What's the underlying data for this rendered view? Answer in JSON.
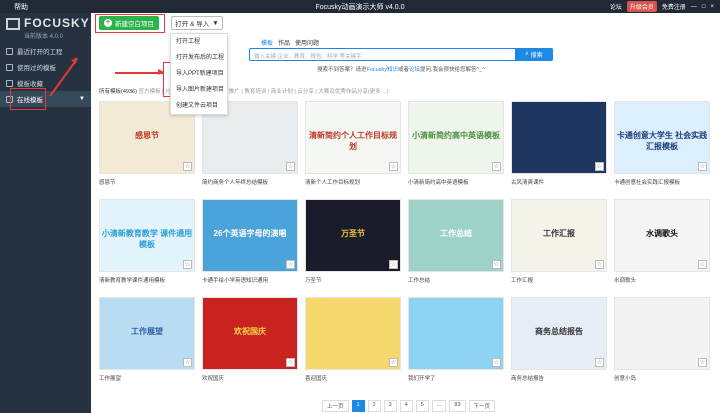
{
  "titlebar": {
    "help": "帮助",
    "title": "Focusky动画演示大师 v4.0.0",
    "forum": "论坛",
    "upgrade": "升级会员",
    "account": "免费注册",
    "min": "—",
    "max": "□",
    "close": "×"
  },
  "sidebar": {
    "logo_name": "FOCUSKY",
    "version": "当前版本 4.0.0",
    "items": [
      {
        "label": "最近打开的工程",
        "icon": "folder-icon"
      },
      {
        "label": "使用过的模板",
        "icon": "template-icon"
      },
      {
        "label": "模板收藏",
        "icon": "star-icon"
      },
      {
        "label": "在线模板",
        "icon": "cloud-icon",
        "caret": "▼"
      }
    ]
  },
  "toolbar": {
    "new_label": "新建空白项目",
    "new_icon": "+",
    "open_label": "打开 & 导入",
    "open_caret": "▼",
    "dropdown": [
      "打开工程",
      "打开发布后的工程",
      "导入PPT新建项目",
      "导入图片新建项目",
      "创建文件云项目"
    ]
  },
  "search": {
    "tabs": [
      "模板",
      "作品",
      "使用问题"
    ],
    "placeholder": "输入关键 企业、教育、报告、科学 等关键字",
    "button": "搜索",
    "hint_before": "搜索不到答案？请进",
    "hint_link1": "Focusky知识",
    "hint_mid": "或者",
    "hint_link2": "论坛",
    "hint_after": "提问,我会很快给您解答^_^"
  },
  "filter": {
    "all": "所有模板(4936)",
    "rest": "官方模板 | 分类模板 | 精选模板 | 企业推广 | 教育培训 | 商业计划 | 云分享 | 大赛及优秀作品分享(更多 ...)"
  },
  "templates": [
    {
      "caption": "感恩节",
      "title": "感恩节",
      "bg": "#f3ead6",
      "color": "#c0392b"
    },
    {
      "caption": "简约商务个人年终总结模板",
      "title": "",
      "bg": "#e9ecef",
      "color": "#333"
    },
    {
      "caption": "清新个人工作目标规划",
      "title": "清新简约个人工作目标规划",
      "bg": "#f4f7f2",
      "color": "#c0392b"
    },
    {
      "caption": "小清新简约高中英语模板",
      "title": "小清新简约高中英语模板",
      "bg": "#eef5ea",
      "color": "#4b8f45"
    },
    {
      "caption": "古风清爽课件",
      "title": "",
      "bg": "#1f3760",
      "color": "#fff"
    },
    {
      "caption": "卡通创意社会实践汇报模板",
      "title": "卡通创意大学生 社会实践汇报模板",
      "bg": "#dcefff",
      "color": "#1d3f7a"
    },
    {
      "caption": "清新教育教学课件通用模板",
      "title": "小清新教育教学 课件通用模板",
      "bg": "#e3f3fb",
      "color": "#2a9fd6"
    },
    {
      "caption": "卡通手绘小学英语知识通用",
      "title": "26个英语字母的演唱",
      "bg": "#4aa3d9",
      "color": "#fff"
    },
    {
      "caption": "万圣节",
      "title": "万圣节",
      "bg": "#1a1c2c",
      "color": "#f3c234"
    },
    {
      "caption": "工作总结",
      "title": "工作总结",
      "bg": "#9ed2c9",
      "color": "#fff"
    },
    {
      "caption": "工作汇报",
      "title": "工作汇报",
      "bg": "#f5f2ea",
      "color": "#333"
    },
    {
      "caption": "水调歌头",
      "title": "水调歌头",
      "bg": "#f4f4f4",
      "color": "#111"
    },
    {
      "caption": "工作展望",
      "title": "工作展望",
      "bg": "#b9dcf2",
      "color": "#2a62a8"
    },
    {
      "caption": "欢祝国庆",
      "title": "欢祝国庆",
      "bg": "#c9231f",
      "color": "#ffd54a"
    },
    {
      "caption": "喜迎国庆",
      "title": "",
      "bg": "#f7d86e",
      "color": "#c62828"
    },
    {
      "caption": "我们开学了",
      "title": "",
      "bg": "#8fd3f4",
      "color": "#fff"
    },
    {
      "caption": "商务总结报告",
      "title": "商务总结报告",
      "bg": "#e6edf5",
      "color": "#333"
    },
    {
      "caption": "创意小岛",
      "title": "",
      "bg": "#f3f3f3",
      "color": "#333"
    }
  ],
  "pager": {
    "prev": "上一页",
    "pages": [
      "1",
      "2",
      "3",
      "4",
      "5",
      "...",
      "83"
    ],
    "next": "下一页",
    "current": "1"
  },
  "colors": {
    "accent": "#1e88e5",
    "green": "#2db34a",
    "annotation": "#e53935",
    "sidebar": "#26323f"
  }
}
